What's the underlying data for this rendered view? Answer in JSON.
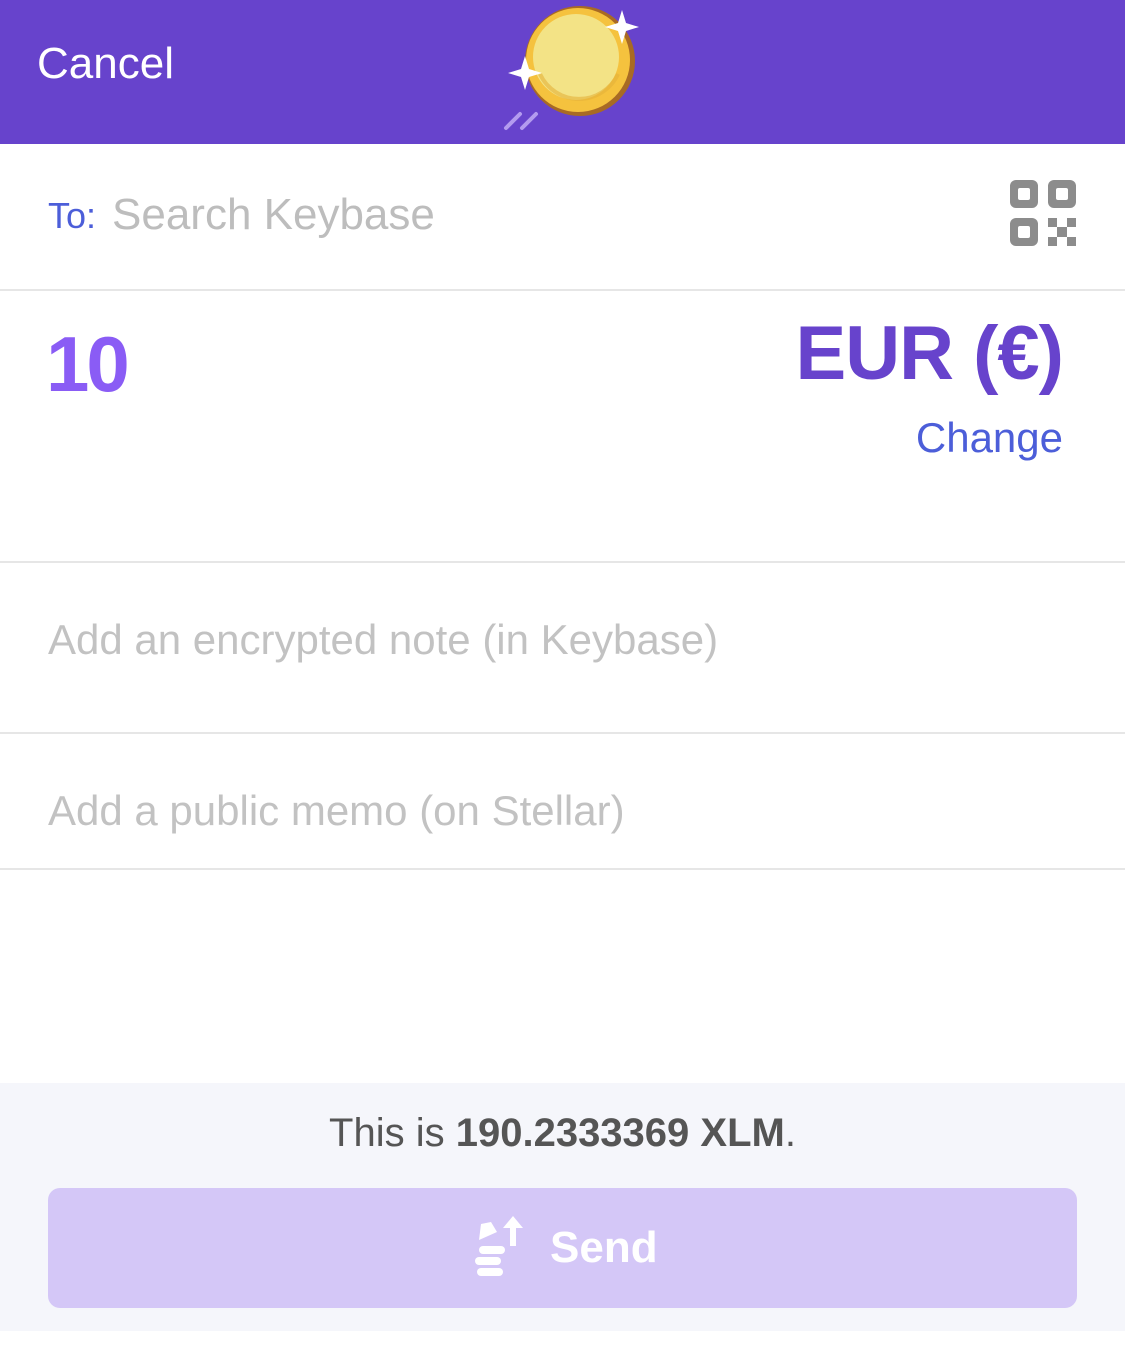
{
  "header": {
    "cancel_label": "Cancel",
    "logo_icon": "gold-coin-icon",
    "background_color": "#6743cc"
  },
  "recipient": {
    "label": "To:",
    "placeholder": "Search Keybase",
    "value": "",
    "scan_icon": "qr-code-icon"
  },
  "amount": {
    "value": "10",
    "currency": "EUR (€)",
    "change_label": "Change"
  },
  "note": {
    "placeholder": "Add an encrypted note (in Keybase)",
    "value": ""
  },
  "memo": {
    "placeholder": "Add a public memo (on Stellar)",
    "value": ""
  },
  "footer": {
    "conversion_prefix": "This is ",
    "conversion_amount": "190.2333369 XLM",
    "conversion_suffix": ".",
    "send_label": "Send",
    "send_icon": "send-coins-icon",
    "send_enabled": false,
    "send_color": "#d4c7f7"
  }
}
